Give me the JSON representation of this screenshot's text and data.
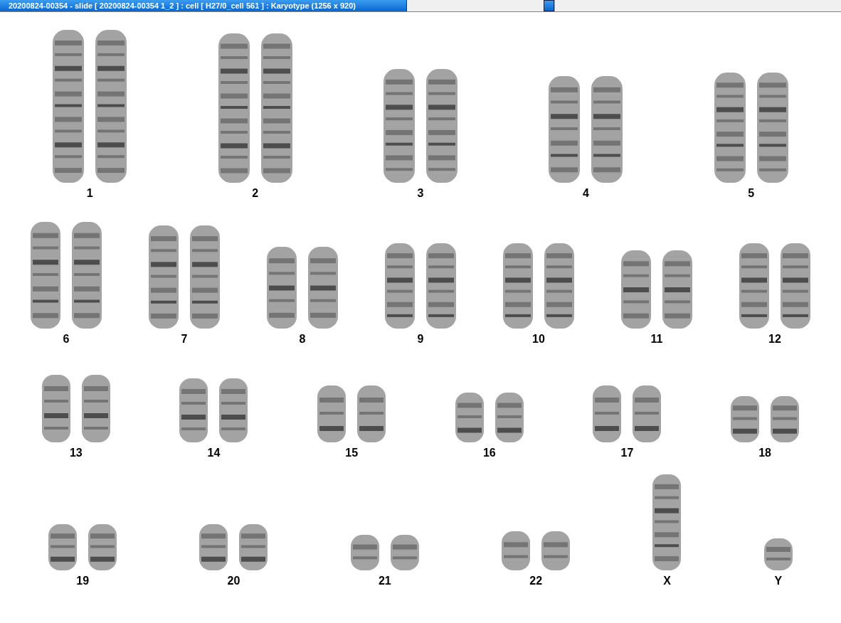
{
  "window": {
    "title": "20200824-00354 - slide [ 20200824-00354 1_2 ] : cell [ H27/0_cell 561 ] : Karyotype  (1256 x 920)"
  },
  "karyotype": {
    "rows": [
      {
        "groups": [
          {
            "label": "1",
            "kind": "pair"
          },
          {
            "label": "2",
            "kind": "pair"
          },
          {
            "label": "3",
            "kind": "pair"
          },
          {
            "label": "4",
            "kind": "pair"
          },
          {
            "label": "5",
            "kind": "pair"
          }
        ]
      },
      {
        "groups": [
          {
            "label": "6",
            "kind": "pair"
          },
          {
            "label": "7",
            "kind": "pair"
          },
          {
            "label": "8",
            "kind": "pair"
          },
          {
            "label": "9",
            "kind": "pair"
          },
          {
            "label": "10",
            "kind": "pair"
          },
          {
            "label": "11",
            "kind": "pair"
          },
          {
            "label": "12",
            "kind": "pair"
          }
        ]
      },
      {
        "groups": [
          {
            "label": "13",
            "kind": "pair"
          },
          {
            "label": "14",
            "kind": "pair"
          },
          {
            "label": "15",
            "kind": "pair"
          },
          {
            "label": "16",
            "kind": "pair"
          },
          {
            "label": "17",
            "kind": "pair"
          },
          {
            "label": "18",
            "kind": "pair"
          }
        ]
      },
      {
        "groups": [
          {
            "label": "19",
            "kind": "pair"
          },
          {
            "label": "20",
            "kind": "pair"
          },
          {
            "label": "21",
            "kind": "pair"
          },
          {
            "label": "22",
            "kind": "pair"
          },
          {
            "label": "X",
            "kind": "single"
          },
          {
            "label": "Y",
            "kind": "single"
          }
        ]
      }
    ]
  }
}
